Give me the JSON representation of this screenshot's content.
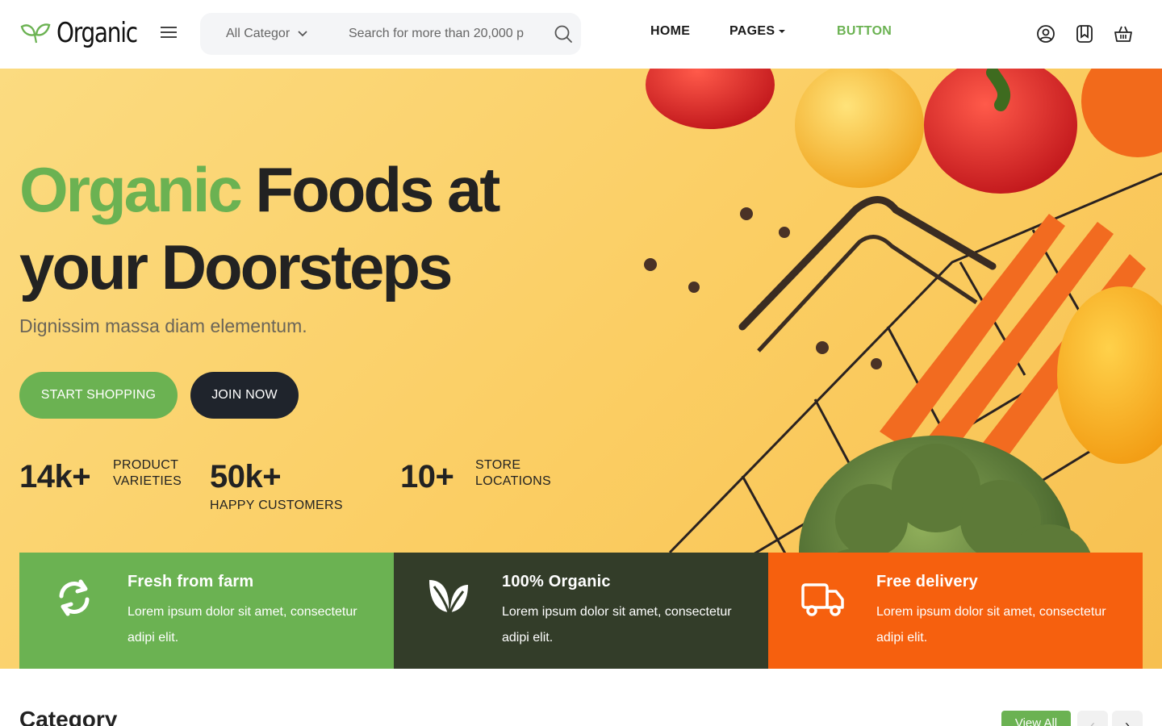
{
  "header": {
    "logo_text": "Organic",
    "search": {
      "category": "All Categor",
      "placeholder": "Search for more than 20,000 p"
    },
    "nav": {
      "home": "HOME",
      "pages": "PAGES",
      "button": "BUTTON"
    },
    "icons": [
      "user-icon",
      "bookmark-icon",
      "basket-icon"
    ]
  },
  "hero": {
    "title_part1": "Organic",
    "title_part2": " Foods at",
    "title_part3": "your ",
    "title_part4": "Doorsteps",
    "subtitle": "Dignissim massa diam elementum.",
    "cta_primary": "START SHOPPING",
    "cta_secondary": "JOIN NOW",
    "stats": [
      {
        "value": "14k+",
        "label_line1": "PRODUCT",
        "label_line2": "VARIETIES"
      },
      {
        "value": "50k+",
        "label_line1": "HAPPY CUSTOMERS"
      },
      {
        "value": "10+",
        "label_line1": "STORE",
        "label_line2": "LOCATIONS"
      }
    ]
  },
  "features": [
    {
      "title": "Fresh from farm",
      "text": "Lorem ipsum dolor sit amet, consectetur adipi elit.",
      "icon": "refresh-icon"
    },
    {
      "title": "100% Organic",
      "text": "Lorem ipsum dolor sit amet, consectetur adipi elit.",
      "icon": "leaf-icon"
    },
    {
      "title": "Free delivery",
      "text": "Lorem ipsum dolor sit amet, consectetur adipi elit.",
      "icon": "truck-icon"
    }
  ],
  "category": {
    "title": "Category",
    "view_all": "View All",
    "prev_symbol": "‹",
    "next_symbol": "›"
  },
  "colors": {
    "accent_green": "#6bb252",
    "dark_green": "#333d29",
    "orange": "#f6600e",
    "dark_button": "#1f242c",
    "hero_bg": "#fbcd62"
  }
}
